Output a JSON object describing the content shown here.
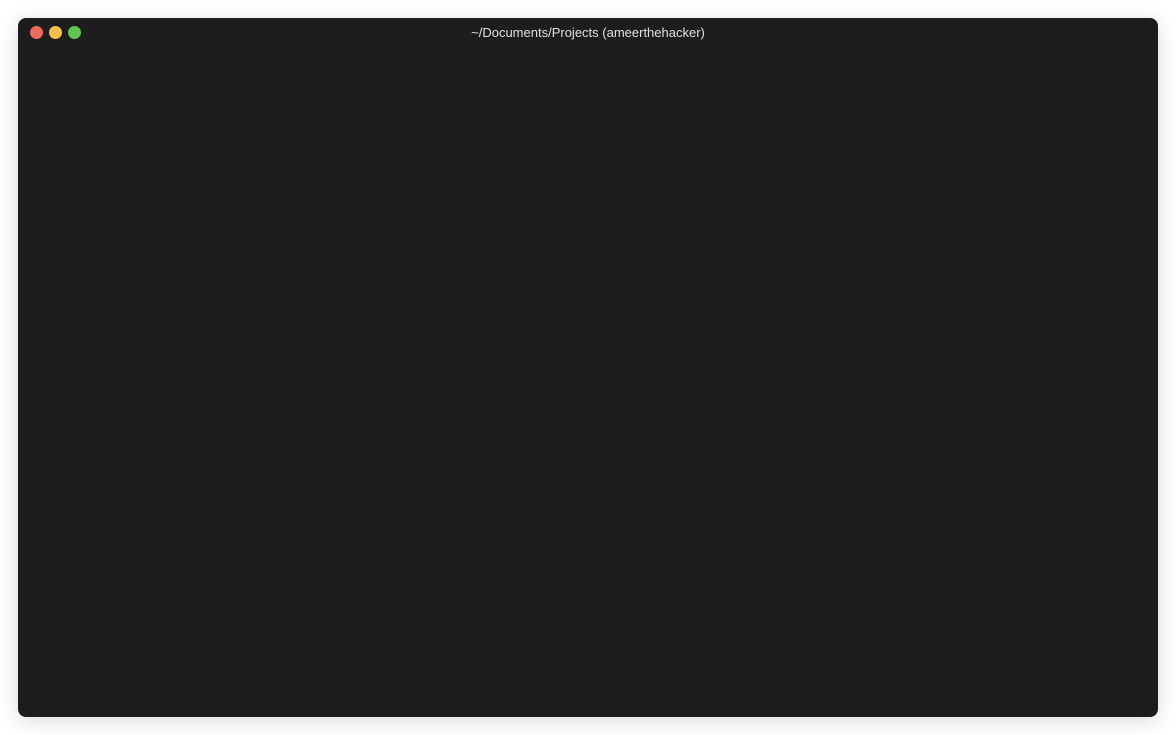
{
  "window": {
    "title": "~/Documents/Projects (ameerthehacker)"
  },
  "traffic_lights": {
    "close_color": "#ed6a5e",
    "minimize_color": "#f4bf4f",
    "maximize_color": "#61c554"
  },
  "terminal": {
    "content": ""
  }
}
